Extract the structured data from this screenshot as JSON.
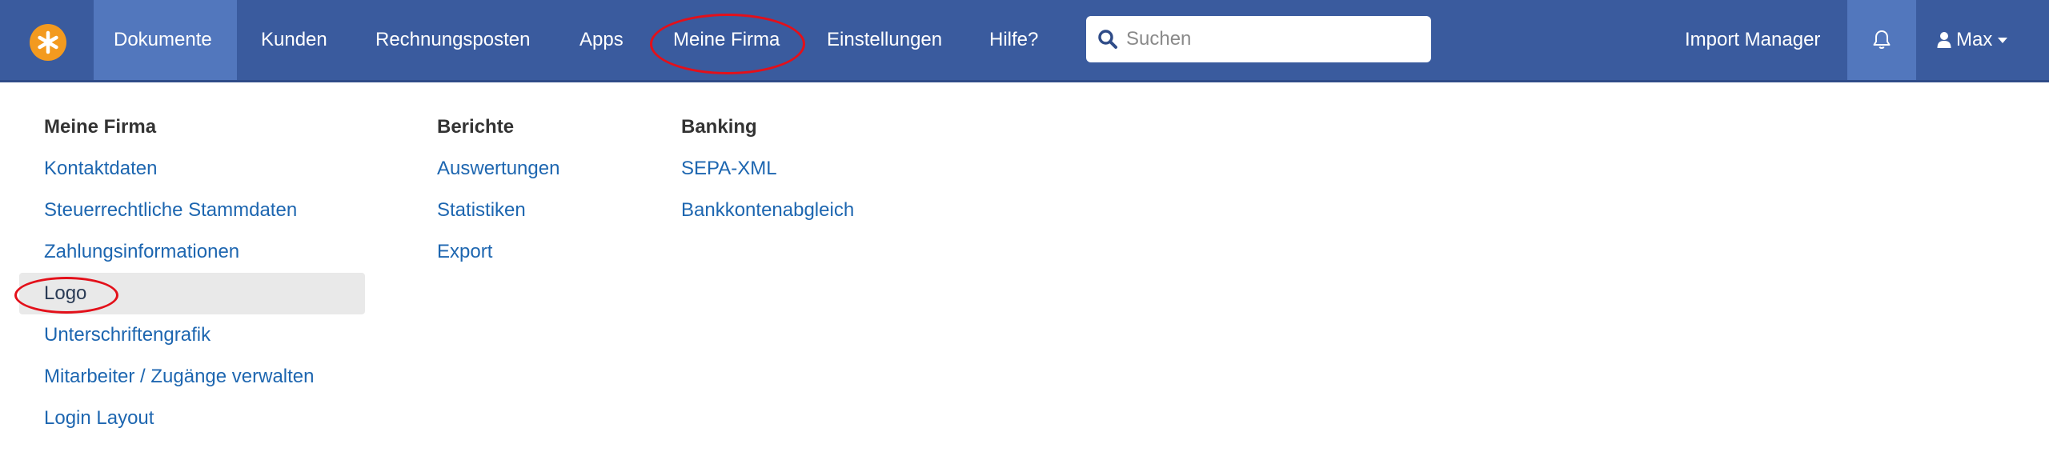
{
  "navbar": {
    "logo_icon": "asterisk-logo-icon",
    "items": [
      {
        "label": "Dokumente",
        "active": true
      },
      {
        "label": "Kunden"
      },
      {
        "label": "Rechnungsposten"
      },
      {
        "label": "Apps"
      },
      {
        "label": "Meine Firma",
        "annotated": true
      },
      {
        "label": "Einstellungen"
      },
      {
        "label": "Hilfe?"
      }
    ],
    "search": {
      "placeholder": "Suchen",
      "value": ""
    },
    "import_manager": "Import Manager",
    "bell_icon": "bell-icon",
    "user": {
      "name": "Max",
      "icon": "user-icon"
    }
  },
  "dropdown": {
    "columns": [
      {
        "heading": "Meine Firma",
        "links": [
          "Kontaktdaten",
          "Steuerrechtliche Stammdaten",
          "Zahlungsinformationen",
          "Logo",
          "Unterschriftengrafik",
          "Mitarbeiter / Zugänge verwalten",
          "Login Layout"
        ]
      },
      {
        "heading": "Berichte",
        "links": [
          "Auswertungen",
          "Statistiken",
          "Export"
        ]
      },
      {
        "heading": "Banking",
        "links": [
          "SEPA-XML",
          "Bankkontenabgleich"
        ]
      }
    ],
    "highlighted_link": "Logo"
  },
  "colors": {
    "navbar_bg": "#3a5b9e",
    "navbar_active": "#5277bd",
    "logo_orange": "#f39a1f",
    "link_blue": "#1d66b0",
    "annotation_red": "#e3101a"
  }
}
